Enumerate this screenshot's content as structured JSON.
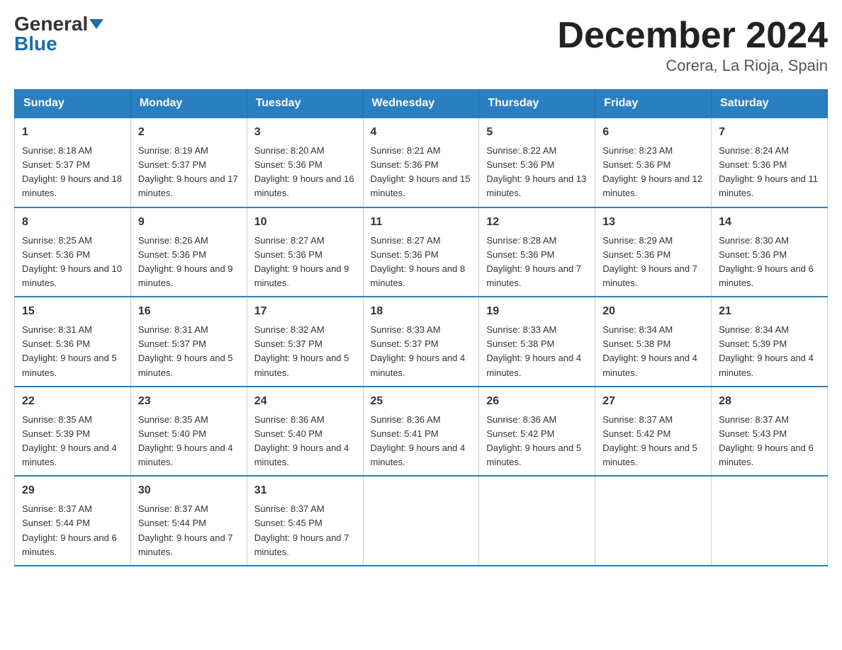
{
  "logo": {
    "text1": "General",
    "text2": "Blue"
  },
  "title": "December 2024",
  "location": "Corera, La Rioja, Spain",
  "headers": [
    "Sunday",
    "Monday",
    "Tuesday",
    "Wednesday",
    "Thursday",
    "Friday",
    "Saturday"
  ],
  "weeks": [
    [
      {
        "day": "1",
        "sunrise": "8:18 AM",
        "sunset": "5:37 PM",
        "daylight": "9 hours and 18 minutes."
      },
      {
        "day": "2",
        "sunrise": "8:19 AM",
        "sunset": "5:37 PM",
        "daylight": "9 hours and 17 minutes."
      },
      {
        "day": "3",
        "sunrise": "8:20 AM",
        "sunset": "5:36 PM",
        "daylight": "9 hours and 16 minutes."
      },
      {
        "day": "4",
        "sunrise": "8:21 AM",
        "sunset": "5:36 PM",
        "daylight": "9 hours and 15 minutes."
      },
      {
        "day": "5",
        "sunrise": "8:22 AM",
        "sunset": "5:36 PM",
        "daylight": "9 hours and 13 minutes."
      },
      {
        "day": "6",
        "sunrise": "8:23 AM",
        "sunset": "5:36 PM",
        "daylight": "9 hours and 12 minutes."
      },
      {
        "day": "7",
        "sunrise": "8:24 AM",
        "sunset": "5:36 PM",
        "daylight": "9 hours and 11 minutes."
      }
    ],
    [
      {
        "day": "8",
        "sunrise": "8:25 AM",
        "sunset": "5:36 PM",
        "daylight": "9 hours and 10 minutes."
      },
      {
        "day": "9",
        "sunrise": "8:26 AM",
        "sunset": "5:36 PM",
        "daylight": "9 hours and 9 minutes."
      },
      {
        "day": "10",
        "sunrise": "8:27 AM",
        "sunset": "5:36 PM",
        "daylight": "9 hours and 9 minutes."
      },
      {
        "day": "11",
        "sunrise": "8:27 AM",
        "sunset": "5:36 PM",
        "daylight": "9 hours and 8 minutes."
      },
      {
        "day": "12",
        "sunrise": "8:28 AM",
        "sunset": "5:36 PM",
        "daylight": "9 hours and 7 minutes."
      },
      {
        "day": "13",
        "sunrise": "8:29 AM",
        "sunset": "5:36 PM",
        "daylight": "9 hours and 7 minutes."
      },
      {
        "day": "14",
        "sunrise": "8:30 AM",
        "sunset": "5:36 PM",
        "daylight": "9 hours and 6 minutes."
      }
    ],
    [
      {
        "day": "15",
        "sunrise": "8:31 AM",
        "sunset": "5:36 PM",
        "daylight": "9 hours and 5 minutes."
      },
      {
        "day": "16",
        "sunrise": "8:31 AM",
        "sunset": "5:37 PM",
        "daylight": "9 hours and 5 minutes."
      },
      {
        "day": "17",
        "sunrise": "8:32 AM",
        "sunset": "5:37 PM",
        "daylight": "9 hours and 5 minutes."
      },
      {
        "day": "18",
        "sunrise": "8:33 AM",
        "sunset": "5:37 PM",
        "daylight": "9 hours and 4 minutes."
      },
      {
        "day": "19",
        "sunrise": "8:33 AM",
        "sunset": "5:38 PM",
        "daylight": "9 hours and 4 minutes."
      },
      {
        "day": "20",
        "sunrise": "8:34 AM",
        "sunset": "5:38 PM",
        "daylight": "9 hours and 4 minutes."
      },
      {
        "day": "21",
        "sunrise": "8:34 AM",
        "sunset": "5:39 PM",
        "daylight": "9 hours and 4 minutes."
      }
    ],
    [
      {
        "day": "22",
        "sunrise": "8:35 AM",
        "sunset": "5:39 PM",
        "daylight": "9 hours and 4 minutes."
      },
      {
        "day": "23",
        "sunrise": "8:35 AM",
        "sunset": "5:40 PM",
        "daylight": "9 hours and 4 minutes."
      },
      {
        "day": "24",
        "sunrise": "8:36 AM",
        "sunset": "5:40 PM",
        "daylight": "9 hours and 4 minutes."
      },
      {
        "day": "25",
        "sunrise": "8:36 AM",
        "sunset": "5:41 PM",
        "daylight": "9 hours and 4 minutes."
      },
      {
        "day": "26",
        "sunrise": "8:36 AM",
        "sunset": "5:42 PM",
        "daylight": "9 hours and 5 minutes."
      },
      {
        "day": "27",
        "sunrise": "8:37 AM",
        "sunset": "5:42 PM",
        "daylight": "9 hours and 5 minutes."
      },
      {
        "day": "28",
        "sunrise": "8:37 AM",
        "sunset": "5:43 PM",
        "daylight": "9 hours and 6 minutes."
      }
    ],
    [
      {
        "day": "29",
        "sunrise": "8:37 AM",
        "sunset": "5:44 PM",
        "daylight": "9 hours and 6 minutes."
      },
      {
        "day": "30",
        "sunrise": "8:37 AM",
        "sunset": "5:44 PM",
        "daylight": "9 hours and 7 minutes."
      },
      {
        "day": "31",
        "sunrise": "8:37 AM",
        "sunset": "5:45 PM",
        "daylight": "9 hours and 7 minutes."
      },
      null,
      null,
      null,
      null
    ]
  ]
}
